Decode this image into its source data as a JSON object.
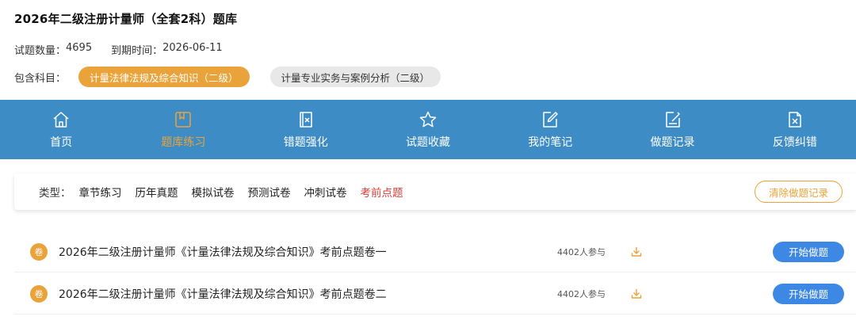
{
  "header": {
    "title": "2026年二级注册计量师（全套2科）题库",
    "question_count_label": "试题数量：",
    "question_count": "4695",
    "expire_label": "到期时间：",
    "expire_date": "2026-06-11",
    "subjects_label": "包含科目：",
    "subjects": [
      {
        "label": "计量法律法规及综合知识（二级）",
        "active": true
      },
      {
        "label": "计量专业实务与案例分析（二级）",
        "active": false
      }
    ]
  },
  "nav": {
    "items": [
      {
        "label": "首页",
        "icon": "home-icon"
      },
      {
        "label": "题库练习",
        "icon": "book-icon",
        "active": true
      },
      {
        "label": "错题强化",
        "icon": "wrong-doc-icon"
      },
      {
        "label": "试题收藏",
        "icon": "star-icon"
      },
      {
        "label": "我的笔记",
        "icon": "edit-icon"
      },
      {
        "label": "做题记录",
        "icon": "record-icon"
      },
      {
        "label": "反馈纠错",
        "icon": "feedback-icon"
      }
    ]
  },
  "filter": {
    "label": "类型：",
    "options": [
      "章节练习",
      "历年真题",
      "模拟试卷",
      "预测试卷",
      "冲刺试卷",
      "考前点题"
    ],
    "active_index": 5,
    "clear_label": "清除做题记录"
  },
  "papers": [
    {
      "badge": "卷",
      "title": "2026年二级注册计量师《计量法律法规及综合知识》考前点题卷一",
      "participants": "4402人参与",
      "start_label": "开始做题"
    },
    {
      "badge": "卷",
      "title": "2026年二级注册计量师《计量法律法规及综合知识》考前点题卷二",
      "participants": "4402人参与",
      "start_label": "开始做题"
    }
  ],
  "colors": {
    "nav_bg": "#3d8cc5",
    "accent_orange": "#e9a33a",
    "active_red": "#d9403a",
    "start_blue": "#3d87e5"
  }
}
